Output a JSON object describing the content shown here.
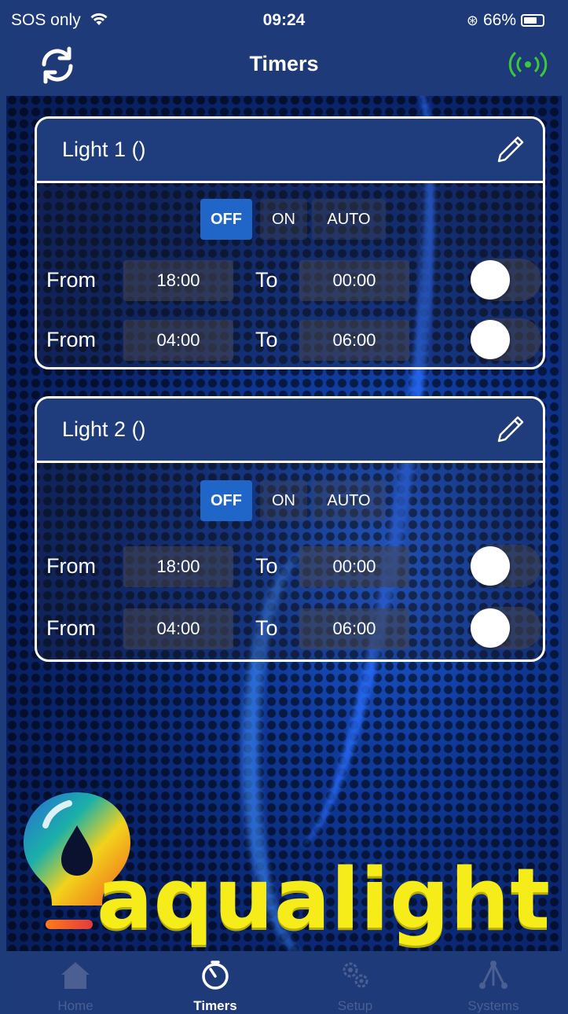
{
  "status_bar": {
    "carrier": "SOS only",
    "time": "09:24",
    "battery": "66%"
  },
  "nav": {
    "title": "Timers"
  },
  "cards": [
    {
      "title": "Light 1 ()",
      "modes": {
        "off": "OFF",
        "on": "ON",
        "auto": "AUTO",
        "selected": "OFF"
      },
      "rows": [
        {
          "from_label": "From",
          "from": "18:00",
          "to_label": "To",
          "to": "00:00",
          "enabled": false
        },
        {
          "from_label": "From",
          "from": "04:00",
          "to_label": "To",
          "to": "06:00",
          "enabled": false
        }
      ]
    },
    {
      "title": "Light 2 ()",
      "modes": {
        "off": "OFF",
        "on": "ON",
        "auto": "AUTO",
        "selected": "OFF"
      },
      "rows": [
        {
          "from_label": "From",
          "from": "18:00",
          "to_label": "To",
          "to": "00:00",
          "enabled": false
        },
        {
          "from_label": "From",
          "from": "04:00",
          "to_label": "To",
          "to": "06:00",
          "enabled": false
        }
      ]
    }
  ],
  "logo": {
    "text": "aqualight",
    "text_color": "#f5ec1a"
  },
  "tabs": [
    {
      "label": "Home",
      "icon": "home-icon"
    },
    {
      "label": "Timers",
      "icon": "timer-icon",
      "active": true
    },
    {
      "label": "Setup",
      "icon": "gears-icon"
    },
    {
      "label": "Systems",
      "icon": "network-icon"
    }
  ],
  "colors": {
    "header": "#1f3a78",
    "accent": "#1f66c8",
    "signal": "#3cc83c"
  }
}
